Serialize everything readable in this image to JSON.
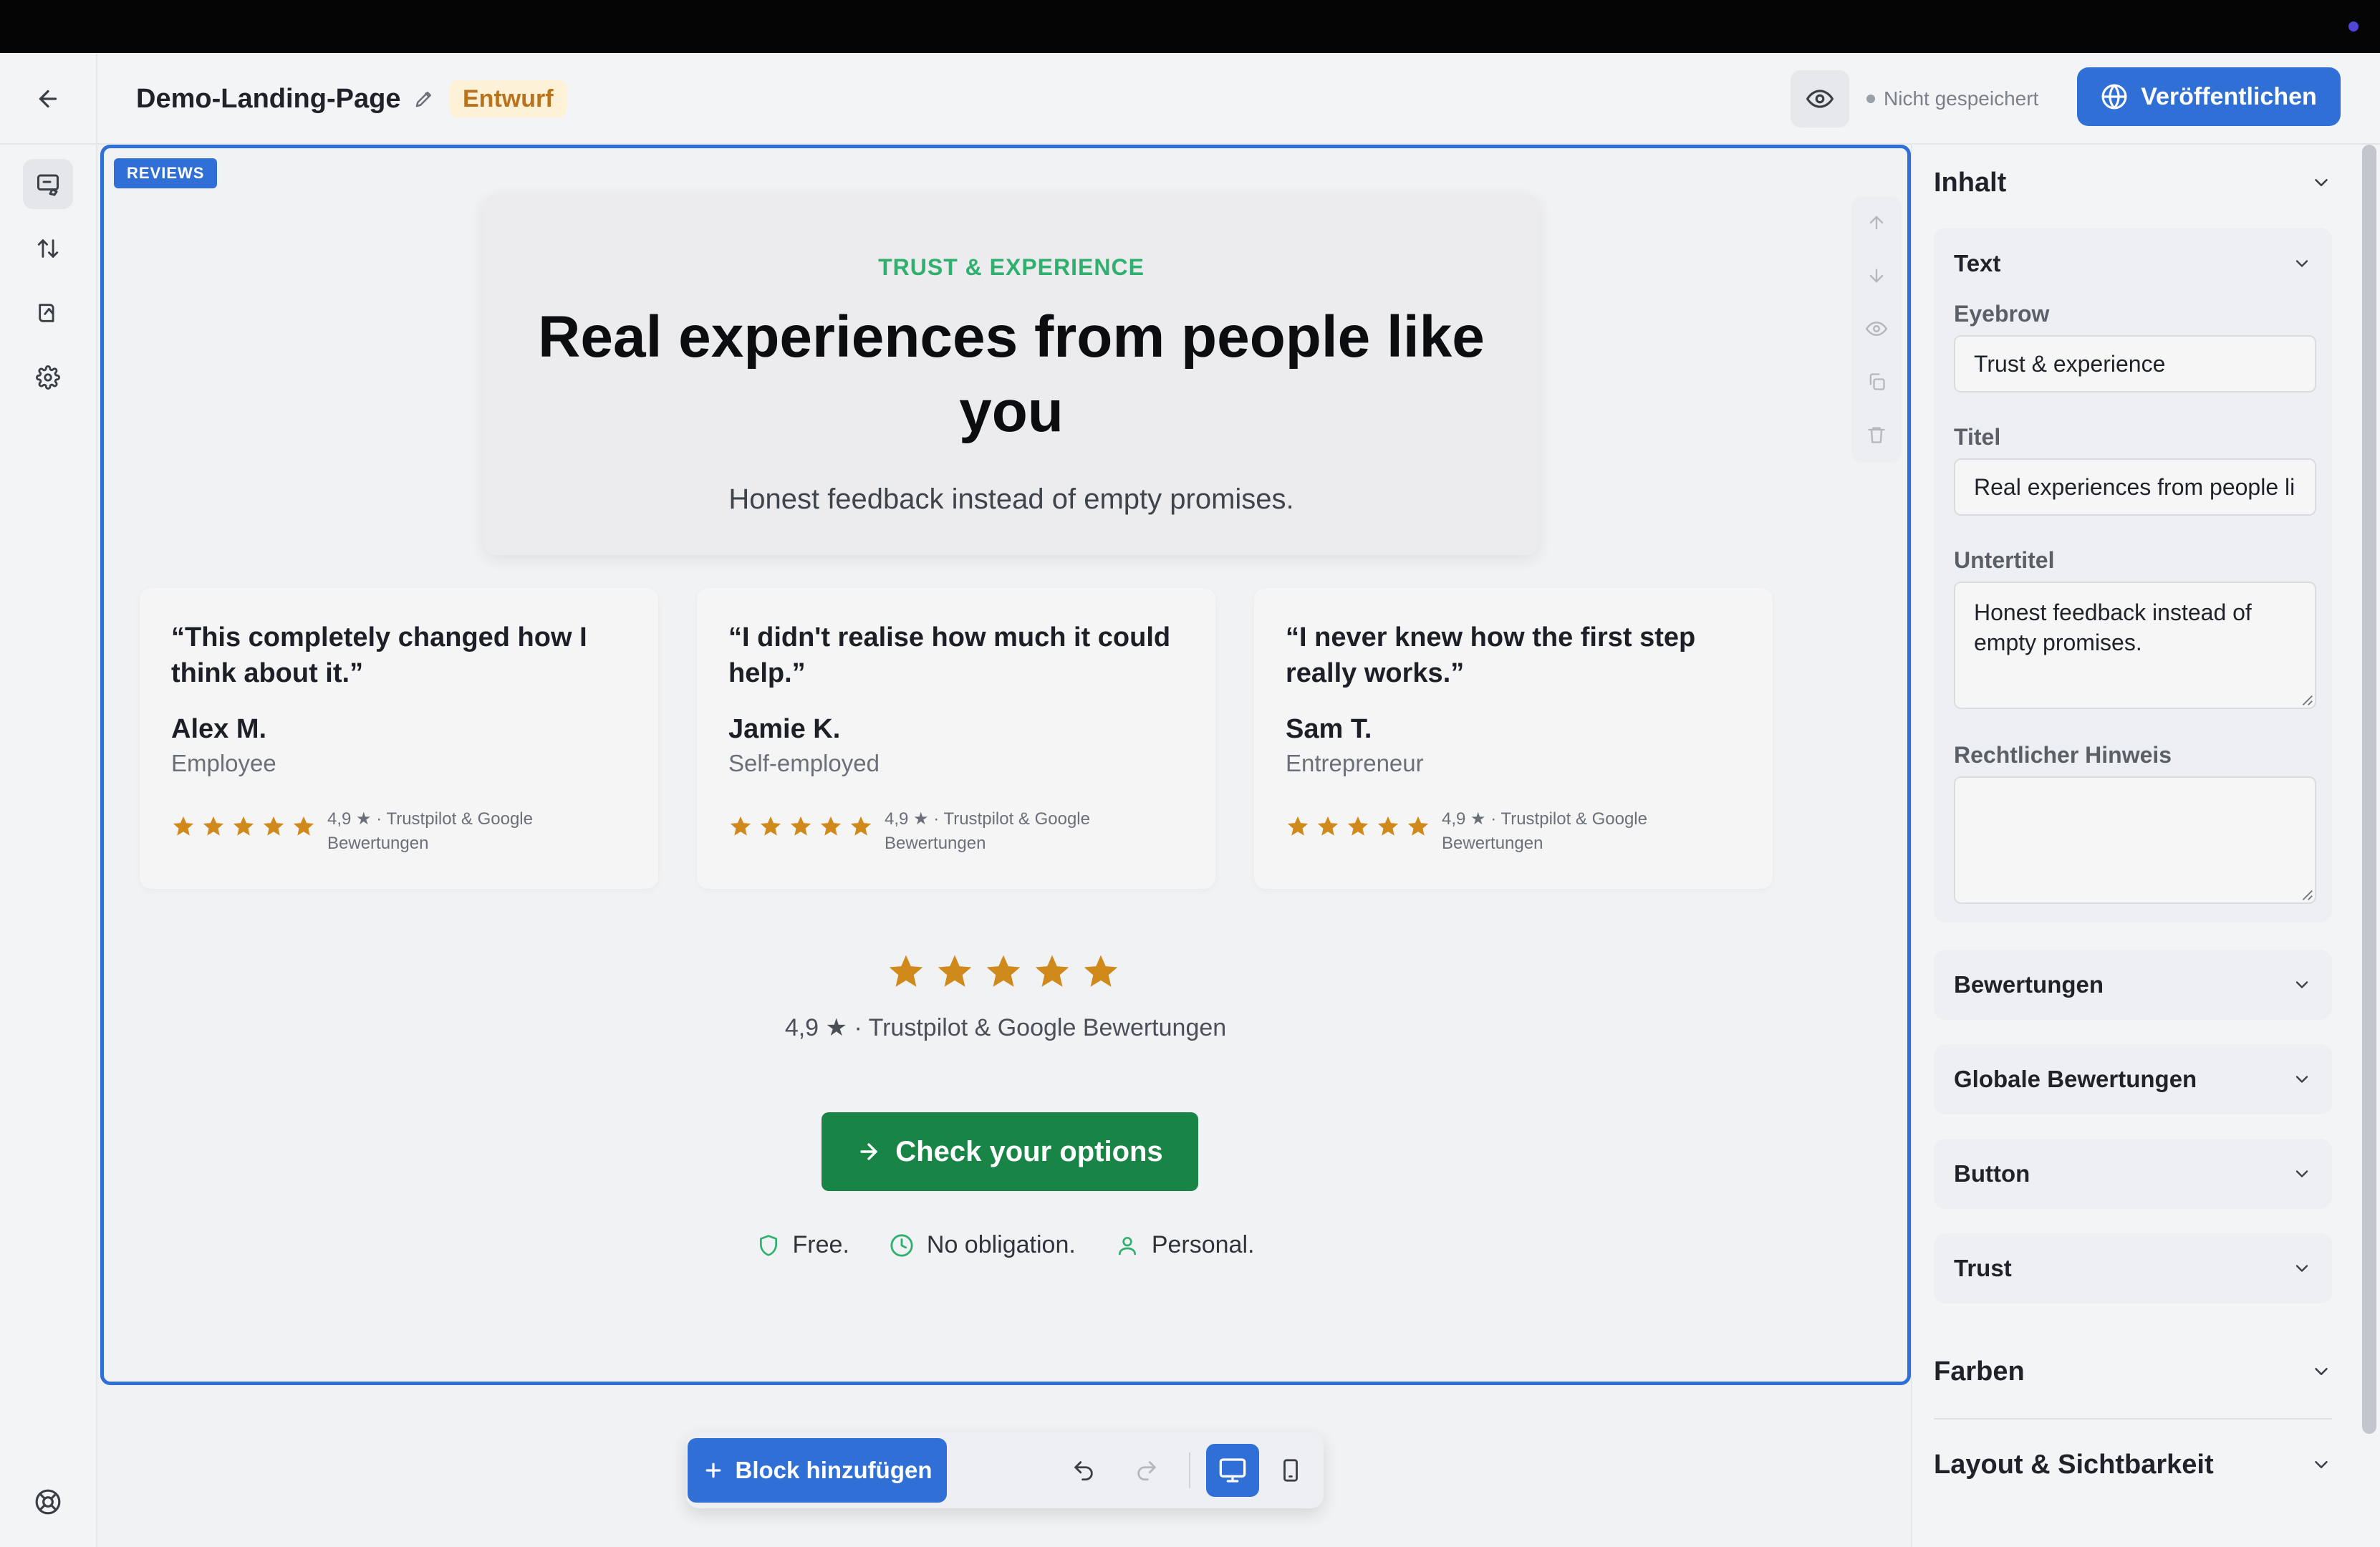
{
  "header": {
    "page_name": "Demo-Landing-Page",
    "status_badge": "Entwurf",
    "save_status": "Nicht gespeichert",
    "publish_label": "Veröffentlichen"
  },
  "section": {
    "tag": "REVIEWS",
    "eyebrow": "TRUST & EXPERIENCE",
    "title": "Real experiences from people like you",
    "subtitle": "Honest feedback instead of empty promises."
  },
  "reviews": [
    {
      "quote": "“This completely changed how I think about it.”",
      "name": "Alex M.",
      "role": "Employee",
      "rating": "4,9 ★ · Trustpilot & Google Bewertungen",
      "stars": 5
    },
    {
      "quote": "“I didn't realise how much it could help.”",
      "name": "Jamie K.",
      "role": "Self-employed",
      "rating": "4,9 ★ · Trustpilot & Google Bewertungen",
      "stars": 5
    },
    {
      "quote": "“I never knew how the first step really works.”",
      "name": "Sam T.",
      "role": "Entrepreneur",
      "rating": "4,9 ★ · Trustpilot & Google Bewertungen",
      "stars": 5
    }
  ],
  "global_rating": {
    "stars": 5,
    "text": "4,9 ★ · Trustpilot & Google Bewertungen"
  },
  "cta": {
    "label": "Check your options"
  },
  "trust": [
    {
      "label": "Free.",
      "icon": "shield-icon"
    },
    {
      "label": "No obligation.",
      "icon": "clock-icon"
    },
    {
      "label": "Personal.",
      "icon": "user-icon"
    }
  ],
  "toolbar": {
    "add_block_label": "Block hinzufügen"
  },
  "panel": {
    "content_title": "Inhalt",
    "text_group_title": "Text",
    "eyebrow_label": "Eyebrow",
    "eyebrow_value": "Trust & experience",
    "title_label": "Titel",
    "title_value": "Real experiences from people like you",
    "subtitle_label": "Untertitel",
    "subtitle_value": "Honest feedback instead of empty promises.",
    "legal_label": "Rechtlicher Hinweis",
    "legal_value": "",
    "groups": [
      "Bewertungen",
      "Globale Bewertungen",
      "Button",
      "Trust"
    ],
    "colors_title": "Farben",
    "layout_title": "Layout & Sichtbarkeit"
  },
  "colors": {
    "accent": "#2f6fd6",
    "eyebrow": "#2fb06f",
    "cta": "#188546",
    "star": "#d08a1c",
    "badge_bg": "#fdf1d8",
    "badge_text": "#b8731c"
  }
}
